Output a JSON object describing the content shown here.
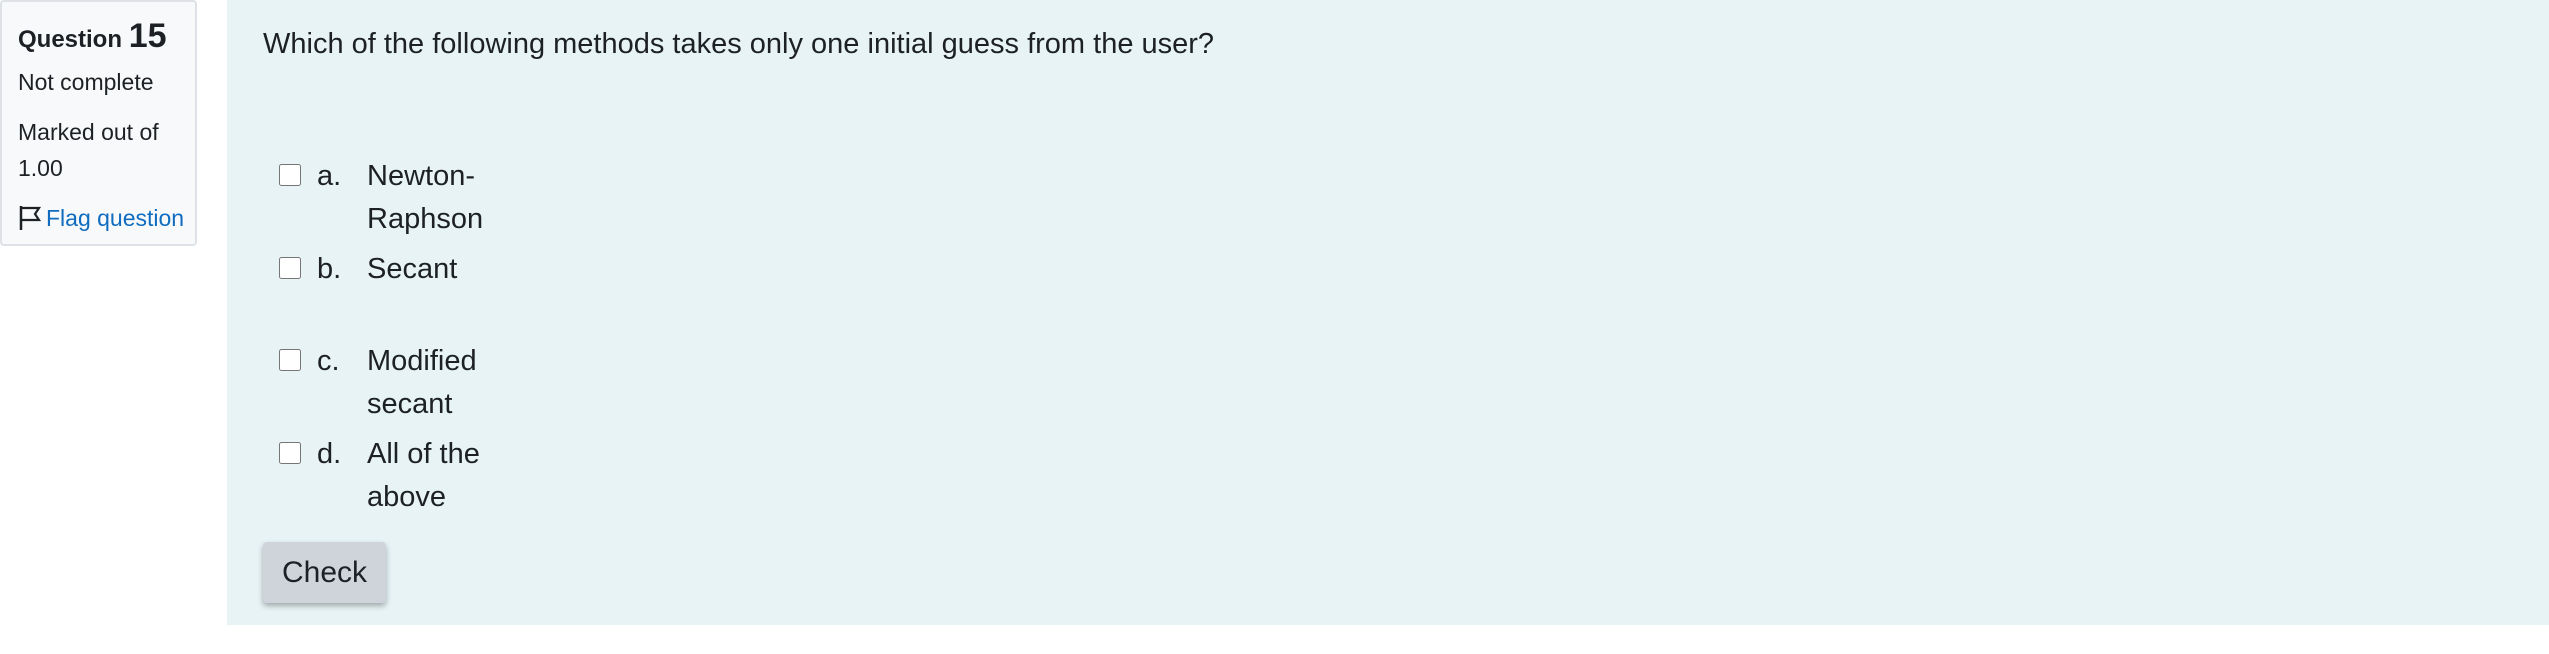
{
  "info": {
    "question_word": "Question",
    "question_number": "15",
    "state": "Not complete",
    "grade_text": "Marked out of 1.00",
    "flag_label": "Flag question",
    "flag_icon": "flag-outline-icon"
  },
  "question": {
    "text": "Which of the following methods takes only one initial guess from the user?",
    "options": [
      {
        "letter": "a.",
        "label": "Newton-Raphson",
        "checked": false
      },
      {
        "letter": "b.",
        "label": "Secant",
        "checked": false
      },
      {
        "letter": "c.",
        "label": "Modified secant",
        "checked": false
      },
      {
        "letter": "d.",
        "label": "All of the above",
        "checked": false
      }
    ],
    "check_label": "Check"
  },
  "colors": {
    "info_bg": "#f8f9fa",
    "content_bg": "#e7f3f5",
    "link": "#0f6cbf",
    "button_bg": "#ced4da"
  }
}
